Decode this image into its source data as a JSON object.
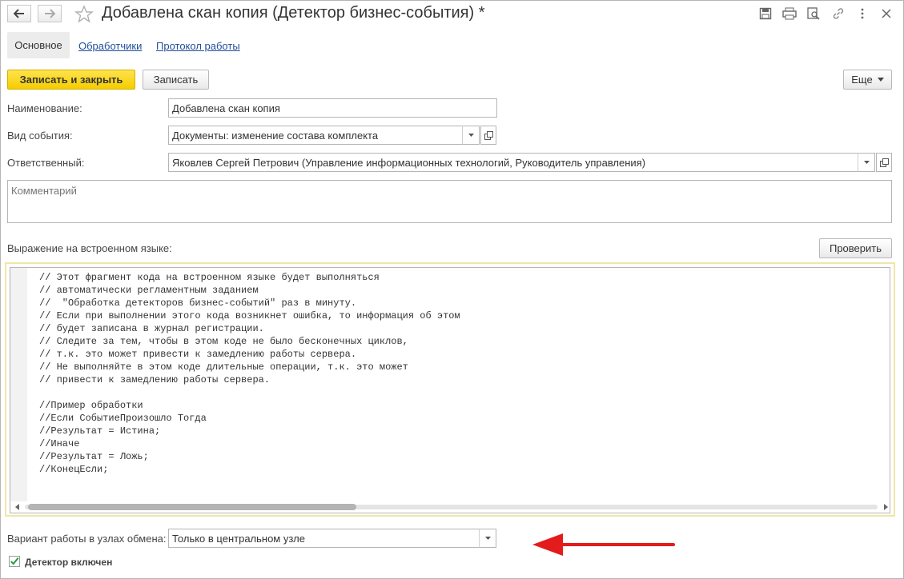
{
  "window": {
    "title": "Добавлена скан копия (Детектор бизнес-события) *"
  },
  "tabs": [
    {
      "label": "Основное",
      "active": true
    },
    {
      "label": "Обработчики",
      "active": false
    },
    {
      "label": "Протокол работы",
      "active": false
    }
  ],
  "toolbar": {
    "save_close_label": "Записать и закрыть",
    "save_label": "Записать",
    "more_label": "Еще"
  },
  "form": {
    "name_label": "Наименование:",
    "name_value": "Добавлена скан копия",
    "event_type_label": "Вид события:",
    "event_type_value": "Документы: изменение состава комплекта",
    "responsible_label": "Ответственный:",
    "responsible_value": "Яковлев Сергей Петрович (Управление информационных технологий, Руководитель управления)",
    "comment_placeholder": "Комментарий",
    "expression_label": "Выражение на встроенном языке:",
    "check_button_label": "Проверить",
    "code_lines": [
      "// Этот фрагмент кода на встроенном языке будет выполняться",
      "// автоматически регламентным заданием",
      "//  \"Обработка детекторов бизнес-событий\" раз в минуту.",
      "// Если при выполнении этого кода возникнет ошибка, то информация об этом",
      "// будет записана в журнал регистрации.",
      "// Следите за тем, чтобы в этом коде не было бесконечных циклов,",
      "// т.к. это может привести к замедлению работы сервера.",
      "// Не выполняйте в этом коде длительные операции, т.к. это может",
      "// привести к замедлению работы сервера.",
      "",
      "//Пример обработки",
      "//Если СобытиеПроизошло Тогда",
      "//Результат = Истина;",
      "//Иначе",
      "//Результат = Ложь;",
      "//КонецЕсли;"
    ],
    "exchange_mode_label": "Вариант работы в узлах обмена:",
    "exchange_mode_value": "Только в центральном узле",
    "detector_enabled_label": "Детектор включен",
    "detector_enabled": true
  },
  "colors": {
    "primary_button": "#f5cd00",
    "link": "#1f4e9a",
    "arrow": "#e31b1b",
    "code_frame": "#f0e6a6"
  }
}
